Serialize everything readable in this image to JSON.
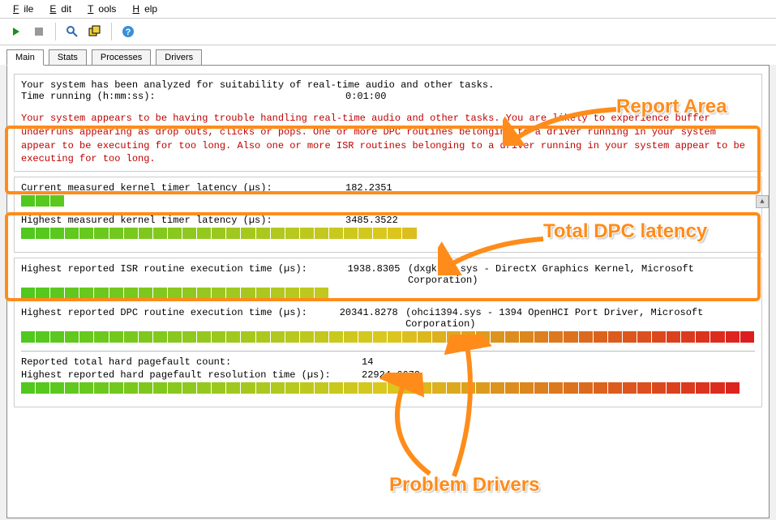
{
  "menu": {
    "file": "File",
    "edit": "Edit",
    "tools": "Tools",
    "help": "Help"
  },
  "tabs": {
    "main": "Main",
    "stats": "Stats",
    "processes": "Processes",
    "drivers": "Drivers"
  },
  "report": {
    "line1": "Your system has been analyzed for suitability of real-time audio and other tasks.",
    "time_label": "Time running (h:mm:ss):",
    "time_value": "0:01:00",
    "warning": "Your system appears to be having trouble handling real-time audio and other tasks. You are likely to experience buffer underruns appearing as drop outs, clicks or pops. One or more DPC routines belonging to a driver running in your system appear to be executing for too long. Also one or more ISR routines belonging to a driver running in your system appear to be executing for too long."
  },
  "latency": {
    "current_label": "Current measured kernel timer latency (µs):",
    "current_value": "182.2351",
    "current_fill": 3,
    "highest_label": "Highest measured kernel timer latency (µs):",
    "highest_value": "3485.3522",
    "highest_fill": 27
  },
  "isr": {
    "label": "Highest reported ISR routine execution time (µs):",
    "value": "1938.8305",
    "driver": "(dxgkrnl.sys - DirectX Graphics Kernel, Microsoft Corporation)",
    "fill": 21
  },
  "dpc": {
    "label": "Highest reported DPC routine execution time (µs):",
    "value": "20341.8278",
    "driver": "(ohci1394.sys - 1394 OpenHCI Port Driver, Microsoft Corporation)",
    "fill": 50
  },
  "pf": {
    "count_label": "Reported total hard pagefault count:",
    "count_value": "14",
    "time_label": "Highest reported hard pagefault resolution time (µs):",
    "time_value": "22924.6672",
    "fill": 49
  },
  "bar_total": 50,
  "annotations": {
    "report": "Report Area",
    "dpc": "Total DPC latency",
    "drivers": "Problem Drivers"
  }
}
